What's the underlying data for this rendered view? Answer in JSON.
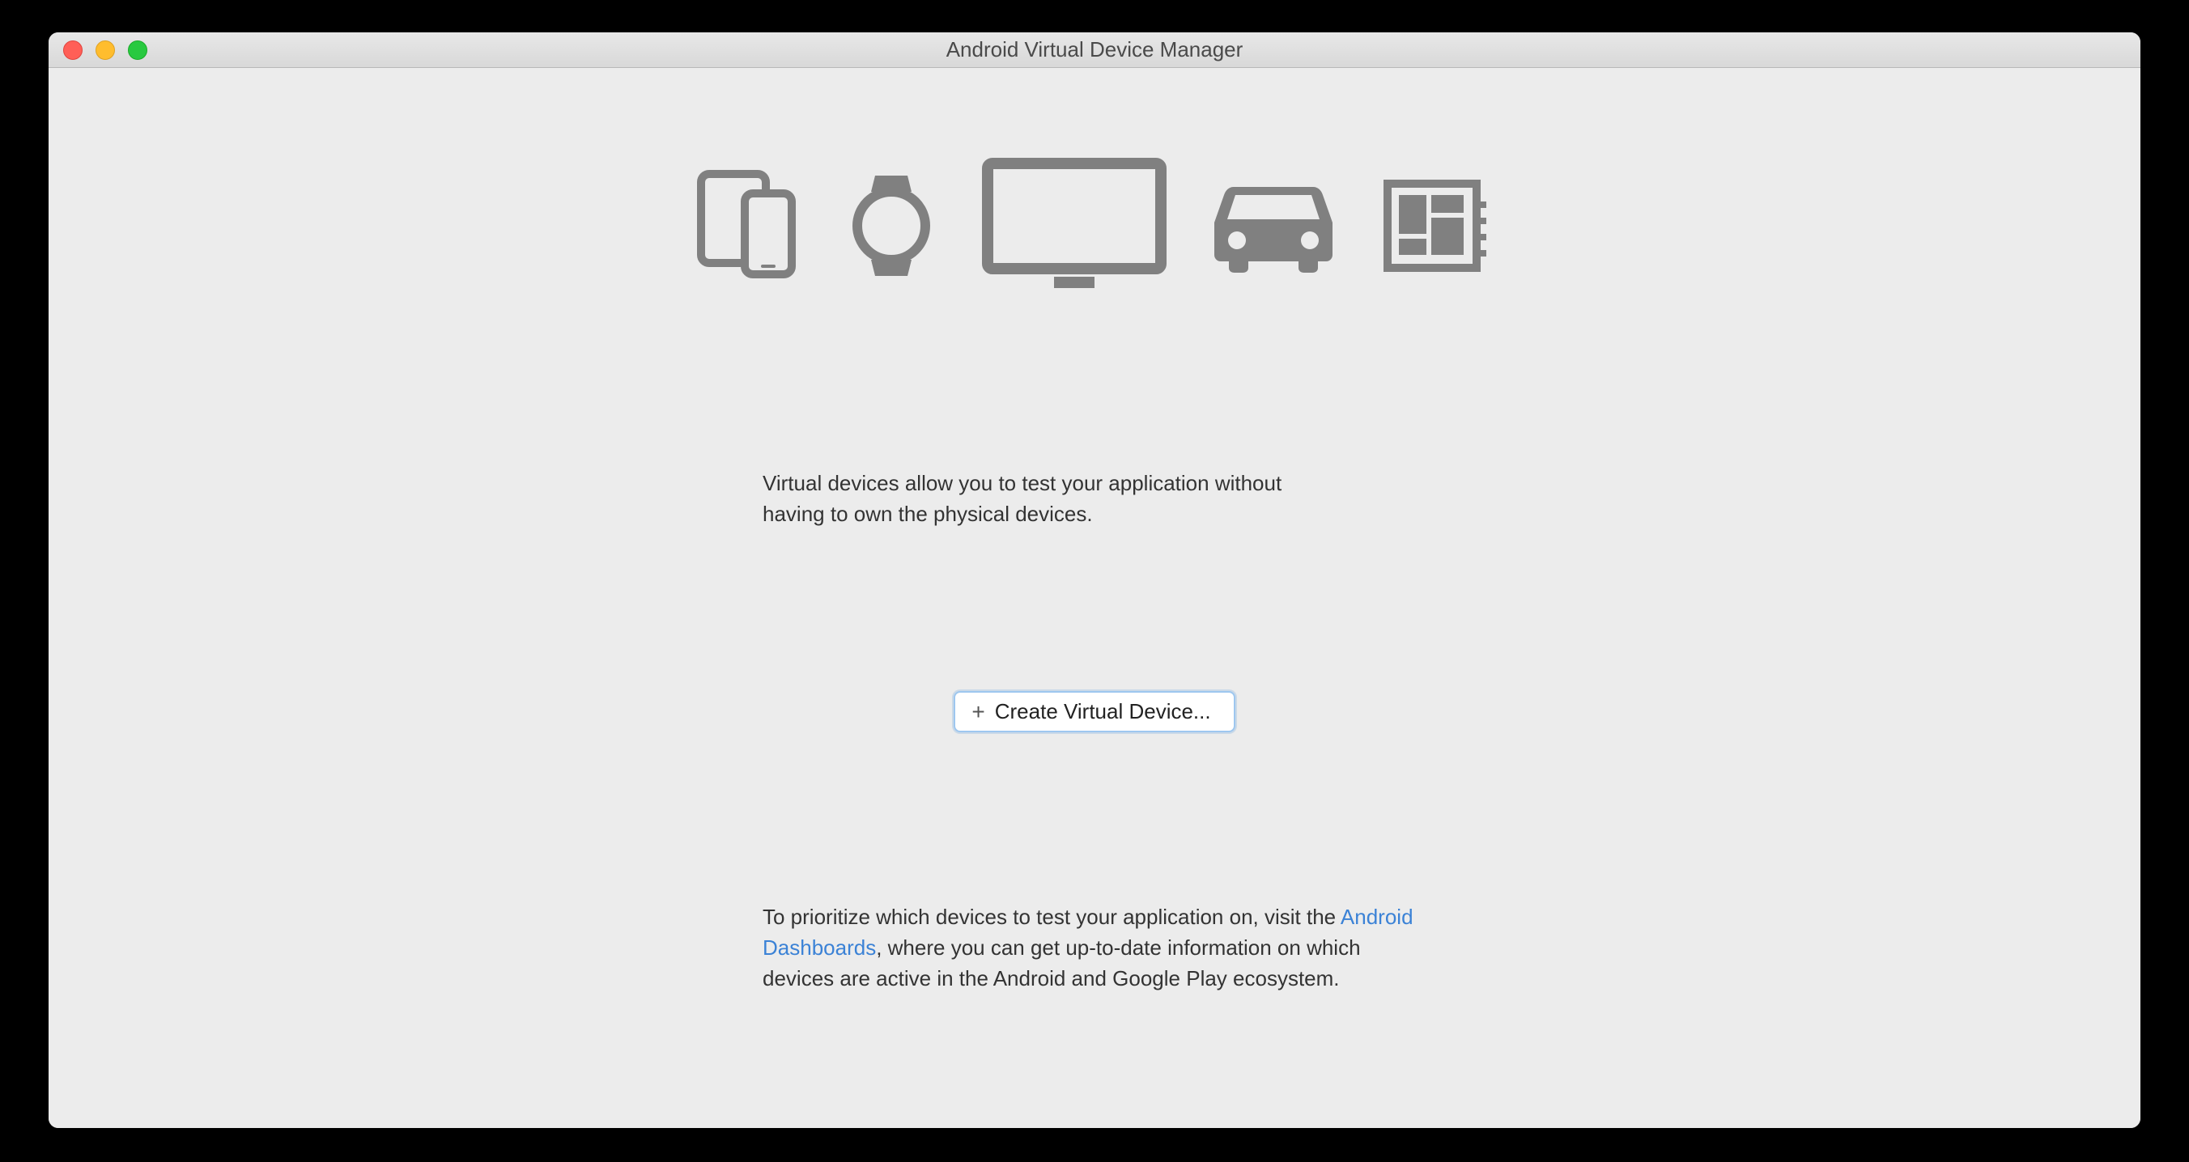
{
  "window": {
    "title": "Android Virtual Device Manager"
  },
  "intro": {
    "line1": "Virtual devices allow you to test your application without",
    "line2": "having to own the physical devices."
  },
  "button": {
    "label": "Create Virtual Device..."
  },
  "footer": {
    "part1": "To prioritize which devices to test your application on, visit the ",
    "link": "Android Dashboards",
    "part2": ", where you can get up-to-date information on which devices are active in the Android and Google Play ecosystem."
  },
  "icons": {
    "phone_tablet": "phone-tablet-icon",
    "watch": "watch-icon",
    "tv": "tv-icon",
    "automotive": "automotive-icon",
    "things": "things-icon"
  },
  "colors": {
    "icon_gray": "#808080",
    "link_blue": "#3b82d6",
    "button_border": "#9ec7ef"
  }
}
